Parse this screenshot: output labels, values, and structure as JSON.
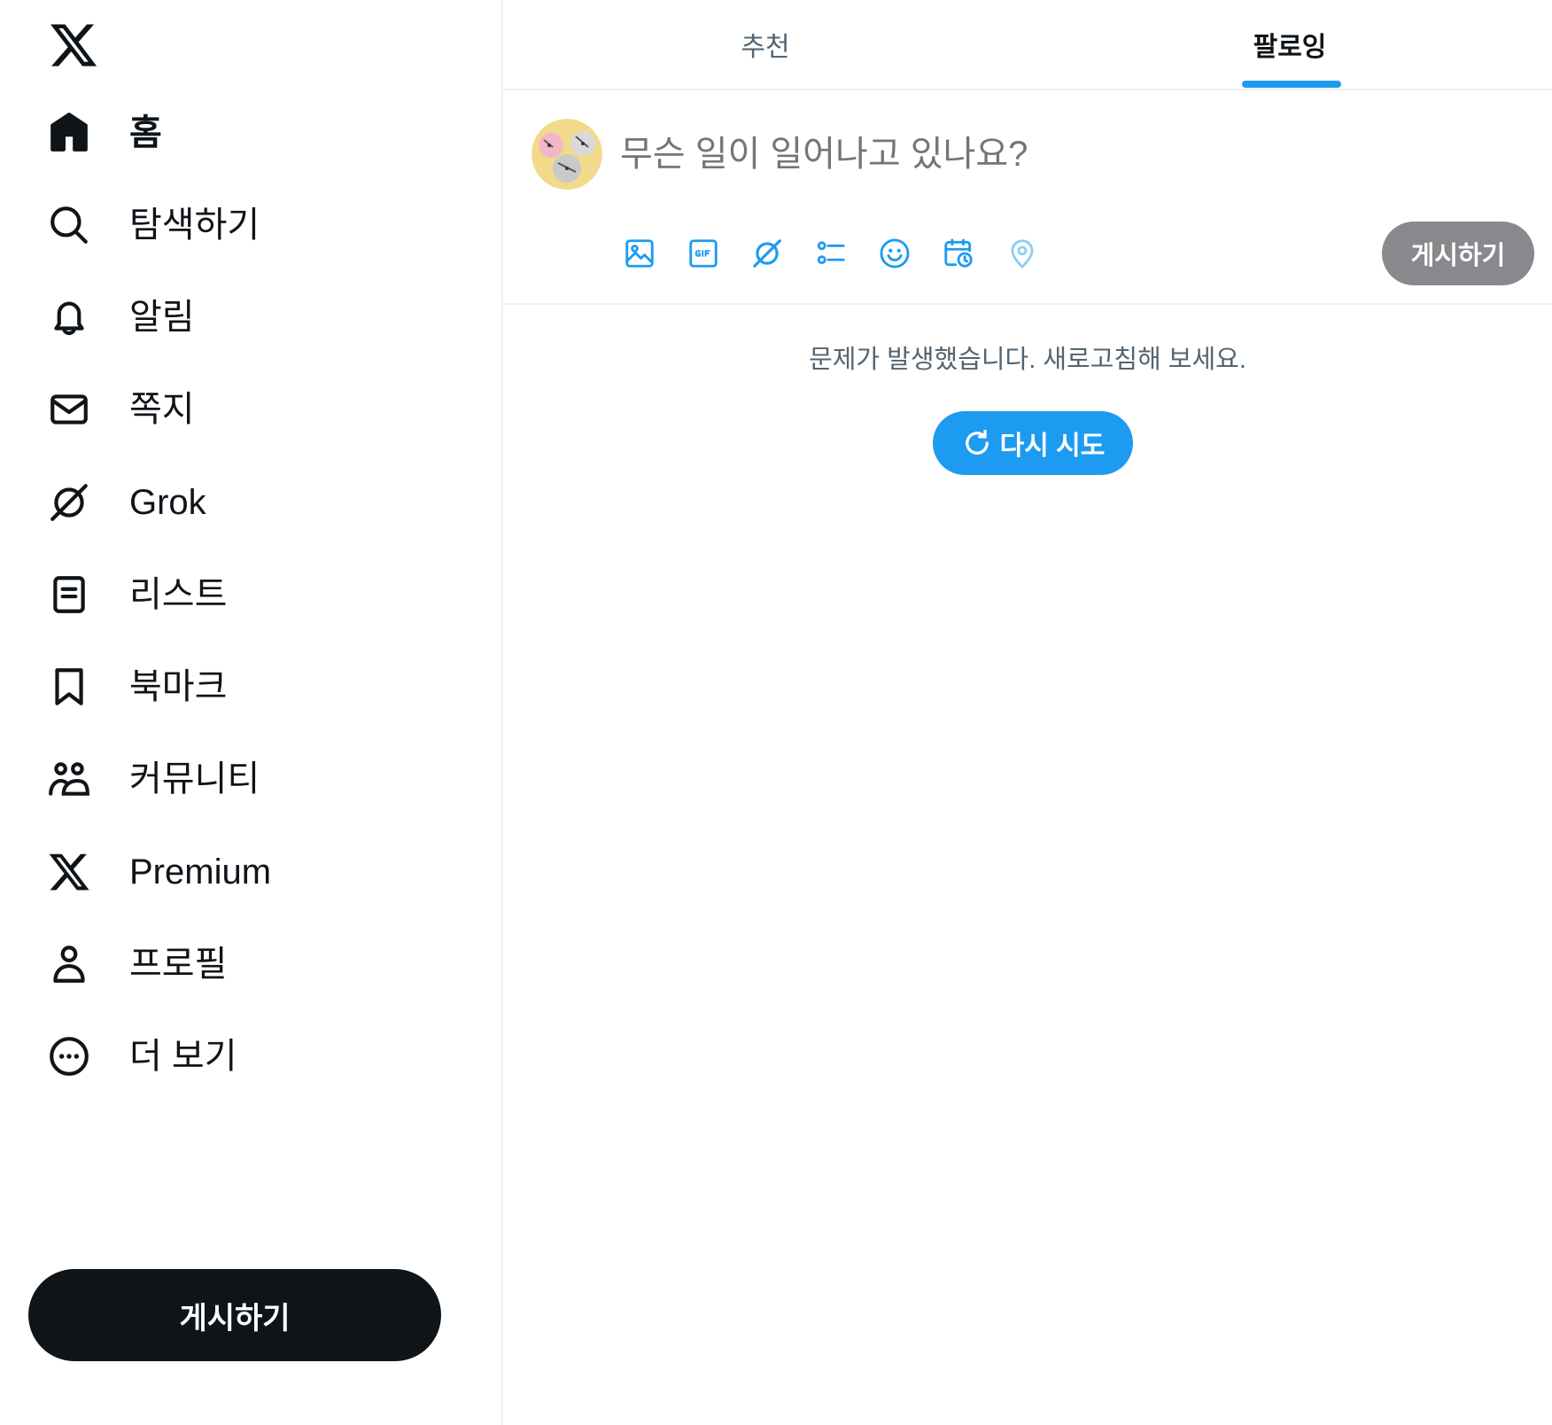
{
  "sidebar": {
    "logo_icon": "x-logo-icon",
    "items": [
      {
        "label": "홈",
        "icon": "home-icon",
        "active": true
      },
      {
        "label": "탐색하기",
        "icon": "search-icon"
      },
      {
        "label": "알림",
        "icon": "bell-icon"
      },
      {
        "label": "쪽지",
        "icon": "envelope-icon"
      },
      {
        "label": "Grok",
        "icon": "grok-icon"
      },
      {
        "label": "리스트",
        "icon": "list-icon"
      },
      {
        "label": "북마크",
        "icon": "bookmark-icon"
      },
      {
        "label": "커뮤니티",
        "icon": "communities-icon"
      },
      {
        "label": "Premium",
        "icon": "x-premium-icon"
      },
      {
        "label": "프로필",
        "icon": "person-icon"
      },
      {
        "label": "더 보기",
        "icon": "more-circle-icon"
      }
    ],
    "post_button": "게시하기"
  },
  "tabs": [
    {
      "label": "추천",
      "active": false
    },
    {
      "label": "팔로잉",
      "active": true
    }
  ],
  "composer": {
    "placeholder": "무슨 일이 일어나고 있나요?",
    "tools": [
      "image-icon",
      "gif-icon",
      "grok-icon",
      "poll-icon",
      "emoji-icon",
      "schedule-icon",
      "location-icon"
    ],
    "post_button": "게시하기"
  },
  "feed": {
    "error_message": "문제가 발생했습니다. 새로고침해 보세요.",
    "retry_button": "다시 시도"
  },
  "colors": {
    "accent": "#1d9bf0",
    "text_primary": "#0f1419",
    "text_secondary": "#536471",
    "border": "#eff3f4",
    "disabled_button": "#87898c"
  }
}
